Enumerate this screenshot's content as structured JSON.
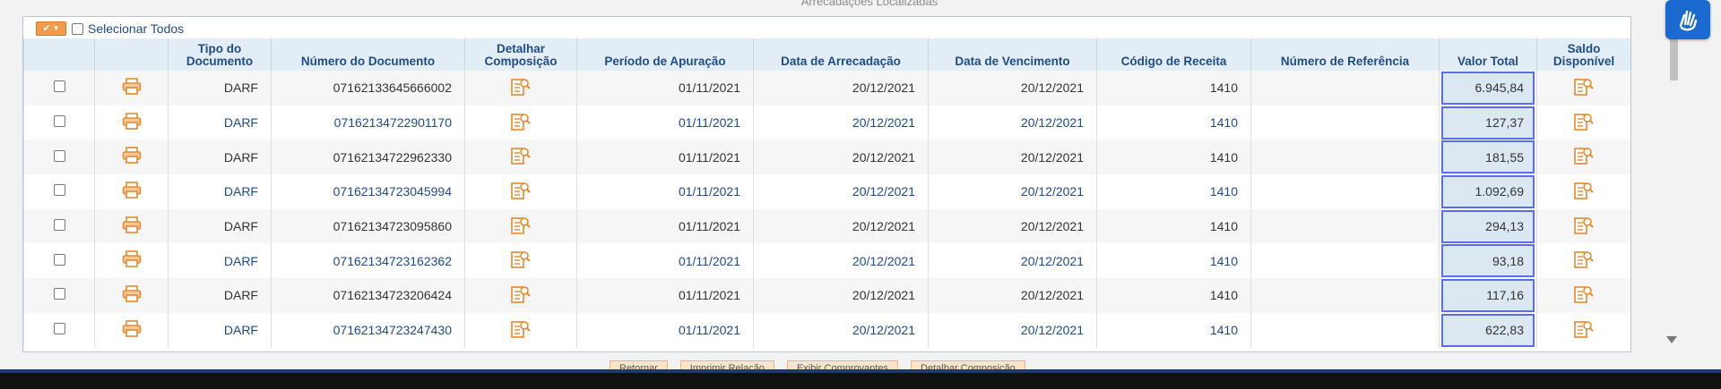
{
  "section_title": "Arrecadações Localizadas",
  "select_all": {
    "label": "Selecionar Todos",
    "checked": false
  },
  "columns": [
    {
      "label": ""
    },
    {
      "label": ""
    },
    {
      "label": "Tipo do Documento"
    },
    {
      "label": "Número do Documento"
    },
    {
      "label": "Detalhar Composição"
    },
    {
      "label": "Período de Apuração"
    },
    {
      "label": "Data de Arrecadação"
    },
    {
      "label": "Data de Vencimento"
    },
    {
      "label": "Código de Receita"
    },
    {
      "label": "Número de Referência"
    },
    {
      "label": "Valor Total"
    },
    {
      "label": "Saldo Disponível"
    }
  ],
  "rows": [
    {
      "tipo": "DARF",
      "numero": "07162133645666002",
      "periodo": "01/11/2021",
      "arrecadacao": "20/12/2021",
      "vencimento": "20/12/2021",
      "codigo": "1410",
      "referencia": "",
      "valor": "6.945,84"
    },
    {
      "tipo": "DARF",
      "numero": "07162134722901170",
      "periodo": "01/11/2021",
      "arrecadacao": "20/12/2021",
      "vencimento": "20/12/2021",
      "codigo": "1410",
      "referencia": "",
      "valor": "127,37"
    },
    {
      "tipo": "DARF",
      "numero": "07162134722962330",
      "periodo": "01/11/2021",
      "arrecadacao": "20/12/2021",
      "vencimento": "20/12/2021",
      "codigo": "1410",
      "referencia": "",
      "valor": "181,55"
    },
    {
      "tipo": "DARF",
      "numero": "07162134723045994",
      "periodo": "01/11/2021",
      "arrecadacao": "20/12/2021",
      "vencimento": "20/12/2021",
      "codigo": "1410",
      "referencia": "",
      "valor": "1.092,69"
    },
    {
      "tipo": "DARF",
      "numero": "07162134723095860",
      "periodo": "01/11/2021",
      "arrecadacao": "20/12/2021",
      "vencimento": "20/12/2021",
      "codigo": "1410",
      "referencia": "",
      "valor": "294,13"
    },
    {
      "tipo": "DARF",
      "numero": "07162134723162362",
      "periodo": "01/11/2021",
      "arrecadacao": "20/12/2021",
      "vencimento": "20/12/2021",
      "codigo": "1410",
      "referencia": "",
      "valor": "93,18"
    },
    {
      "tipo": "DARF",
      "numero": "07162134723206424",
      "periodo": "01/11/2021",
      "arrecadacao": "20/12/2021",
      "vencimento": "20/12/2021",
      "codigo": "1410",
      "referencia": "",
      "valor": "117,16"
    },
    {
      "tipo": "DARF",
      "numero": "07162134723247430",
      "periodo": "01/11/2021",
      "arrecadacao": "20/12/2021",
      "vencimento": "20/12/2021",
      "codigo": "1410",
      "referencia": "",
      "valor": "622,83"
    }
  ],
  "actions": [
    {
      "label": "Retornar"
    },
    {
      "label": "Imprimir Relação"
    },
    {
      "label": "Exibir Comprovantes"
    },
    {
      "label": "Detalhar Composição"
    }
  ],
  "icons": {
    "print": "printer-icon",
    "detail": "document-search-icon",
    "accessibility": "sign-language-icon"
  },
  "colors": {
    "accent_orange": "#f29b4b",
    "header_bg": "#e2edf6",
    "link_blue": "#1e4b8a",
    "selection_border": "#5b6cf0"
  }
}
